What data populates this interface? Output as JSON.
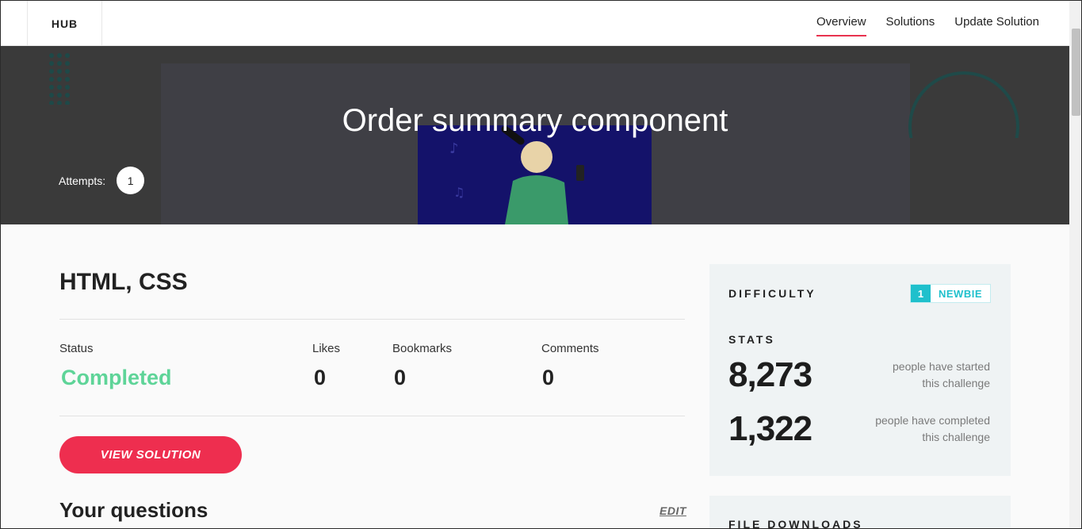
{
  "nav": {
    "brand": "HUB",
    "links": [
      "Overview",
      "Solutions",
      "Update Solution"
    ]
  },
  "hero": {
    "title": "Order summary component",
    "attempts_label": "Attempts:",
    "attempts_count": "1"
  },
  "main": {
    "tech": "HTML, CSS",
    "stats": {
      "status_label": "Status",
      "status_value": "Completed",
      "likes_label": "Likes",
      "likes_value": "0",
      "bookmarks_label": "Bookmarks",
      "bookmarks_value": "0",
      "comments_label": "Comments",
      "comments_value": "0"
    },
    "view_solution": "VIEW SOLUTION",
    "questions_title": "Your questions",
    "edit": "EDIT"
  },
  "sidebar": {
    "difficulty_label": "DIFFICULTY",
    "difficulty_level": "1",
    "difficulty_name": "NEWBIE",
    "stats_label": "STATS",
    "started_count": "8,273",
    "started_text_1": "people have started",
    "started_text_2": "this challenge",
    "completed_count": "1,322",
    "completed_text_1": "people have completed",
    "completed_text_2": "this challenge",
    "downloads_label": "FILE DOWNLOADS"
  },
  "colors": {
    "accent": "#ee2e4f",
    "completed": "#5ed498",
    "newbie": "#1fc0cc"
  }
}
